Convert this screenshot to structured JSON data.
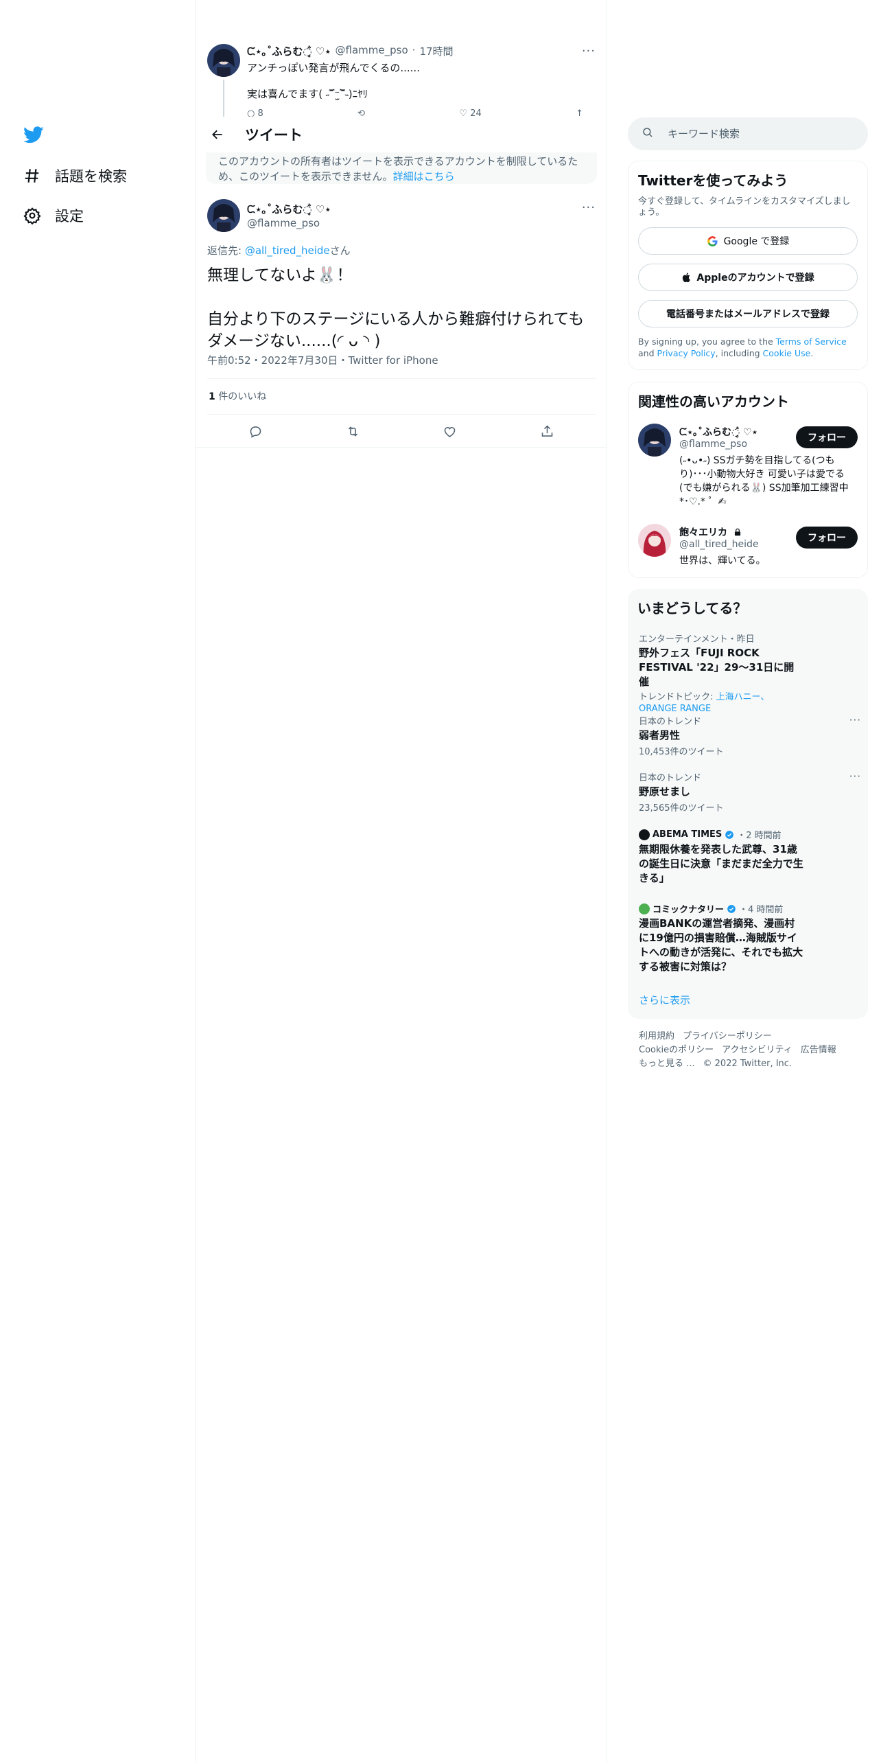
{
  "nav": {
    "explore_label": "話題を検索",
    "settings_label": "設定"
  },
  "parent_tweet": {
    "name": "ᙅ⋆｡˚ふらむ◌̥̐ ♡⋆",
    "handle": "@flamme_pso",
    "time": "17時間",
    "line1": "アンチっぽい発言が飛んでくるの......",
    "line2": "実は喜んでます( ˶‾᷄⁻̫‾᷅˵)ﾆﾔﾘ",
    "reply_count": "8",
    "like_count": "24"
  },
  "header": {
    "title": "ツイート"
  },
  "notice": {
    "text": "このアカウントの所有者はツイートを表示できるアカウントを制限しているため、このツイートを表示できません。",
    "link": "詳細はこちら"
  },
  "tweet": {
    "name": "ᙅ⋆｡˚ふらむ◌̥̐ ♡⋆",
    "handle": "@flamme_pso",
    "reply_prefix": "返信先: ",
    "reply_to": "@all_tired_heide",
    "reply_suffix": "さん",
    "line1": "無理してないよ🐰！",
    "line2": "自分より下のステージにいる人から難癖付けられてもダメージない......(◜ ᴗ ◝ )",
    "timestamp": "午前0:52・2022年7月30日・Twitter for iPhone",
    "likes_count": "1",
    "likes_label": "件のいいね"
  },
  "search": {
    "placeholder": "キーワード検索"
  },
  "signup": {
    "title": "Twitterを使ってみよう",
    "subtitle": "今すぐ登録して、タイムラインをカスタマイズしましょう。",
    "google_label": "Google で登録",
    "apple_label": "Appleのアカウントで登録",
    "phone_label": "電話番号またはメールアドレスで登録",
    "tos_prefix": "By signing up, you agree to the ",
    "tos_link": "Terms of Service",
    "tos_and": " and ",
    "privacy_link": "Privacy Policy",
    "tos_including": ", including ",
    "cookie_link": "Cookie Use",
    "tos_end": "."
  },
  "related": {
    "title": "関連性の高いアカウント",
    "accounts": [
      {
        "name": "ᙅ⋆｡˚ふらむ◌̥̐ ♡⋆",
        "handle": "@flamme_pso",
        "bio": "(˶•ᴗ•˶) SSガチ勢を目指してる(つもり)･･･小動物大好き 可愛い子は愛でる(でも嫌がられる🐰) SS加筆加工練習中*･♡.* ゜✍",
        "follow": "フォロー"
      },
      {
        "name": "飽々エリカ",
        "handle": "@all_tired_heide",
        "bio": "世界は、輝いてる。",
        "follow": "フォロー"
      }
    ]
  },
  "trends": {
    "title": "いまどうしてる？",
    "items": [
      {
        "context": "エンターテインメント・昨日",
        "title": "野外フェス「FUJI ROCK FESTIVAL '22」29～31日に開催",
        "topics_label": "トレンドトピック: ",
        "topics": "上海ハニー、ORANGE RANGE"
      },
      {
        "context": "日本のトレンド",
        "title": "弱者男性",
        "count": "10,453件のツイート"
      },
      {
        "context": "日本のトレンド",
        "title": "野原せまし",
        "count": "23,565件のツイート"
      },
      {
        "source": "ABEMA TIMES",
        "time": "・2 時間前",
        "title": "無期限休養を発表した武尊、31歳の誕生日に決意「まだまだ全力で生きる」"
      },
      {
        "source": "コミックナタリー",
        "time": "・4 時間前",
        "title": "漫画BANKの運営者摘発、漫画村に19億円の損害賠償…海賊版サイトへの動きが活発に、それでも拡大する被害に対策は？"
      }
    ],
    "show_more": "さらに表示"
  },
  "footer": {
    "terms": "利用規約",
    "privacy": "プライバシーポリシー",
    "cookie": "Cookieのポリシー",
    "accessibility": "アクセシビリティ",
    "ads": "広告情報",
    "more": "もっと見る ...",
    "copyright": "© 2022 Twitter, Inc."
  },
  "colors": {
    "accent": "#1d9bf0",
    "text": "#0f1419",
    "muted": "#536471",
    "border": "#eff3f4"
  }
}
